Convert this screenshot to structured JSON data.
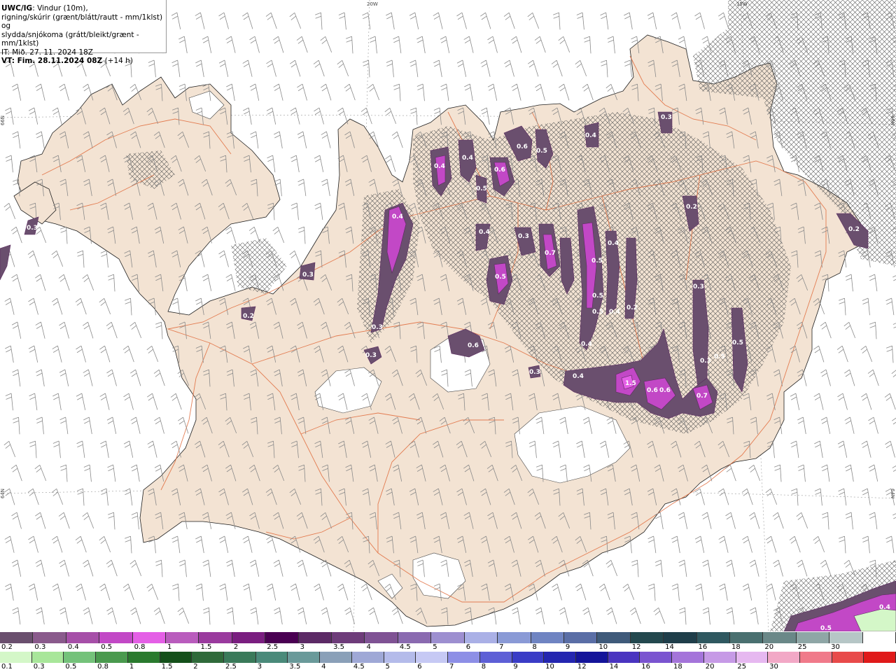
{
  "header": {
    "model": "UWC/IG",
    "line1_rest": ": Vindur (10m),",
    "line2": "rigning/skúrir (grænt/blátt/rautt - mm/1klst) og",
    "line3": "slydda/snjókoma (grátt/bleikt/grænt - mm/1klst)",
    "line4": "IT: Mið. 27. 11. 2024 18Z",
    "vt_label": "VT: Fim. 28.11.2024 08Z",
    "vt_offset": " (+14 h)"
  },
  "geo_labels": {
    "lon_20w": "20W",
    "lon_15w": "15W",
    "lat_66n_left": "66N",
    "lat_66n_right": "66N",
    "lat_64n_left": "64N",
    "lat_64n_right": "64N"
  },
  "precip_labels": [
    "0.3",
    "0.3",
    "0.2",
    "0.4",
    "0.3",
    "0.2",
    "0.6",
    "0.3",
    "0.4",
    "0.4",
    "0.5",
    "0.6",
    "0.6",
    "0.4",
    "0.5",
    "0.4",
    "0.3",
    "0.5",
    "0.7",
    "0.5",
    "0.5",
    "0.4",
    "0.2",
    "0.5",
    "0.3",
    "0.4",
    "0.3",
    "0.2",
    "0.4",
    "0.5",
    "0.7",
    "0.6",
    "1.5",
    "0.6",
    "0.5",
    "0.3",
    "0.4",
    "0.5",
    "0.3",
    "0.2"
  ],
  "legend_top": {
    "colors": [
      "#6a4f6e",
      "#8a5a8c",
      "#a64fa8",
      "#c248c6",
      "#e45fe6",
      "#b95cbd",
      "#9a3a9e",
      "#7a1e80",
      "#4a0052",
      "#5c2a66",
      "#6e3c7a",
      "#7f5294",
      "#8a6ab0",
      "#9d8fd0",
      "#aab0e6",
      "#8a9ad6",
      "#6f84c2",
      "#5a6ea6",
      "#3f5a7a",
      "#23484e",
      "#1f3e4a",
      "#2f5860",
      "#4a7070",
      "#6a8888",
      "#8fa6a6",
      "#b6c6c6",
      "#ffffff"
    ],
    "ticks": [
      "0.2",
      "0.3",
      "0.4",
      "0.5",
      "0.8",
      "1",
      "1.5",
      "2",
      "2.5",
      "3",
      "3.5",
      "4",
      "4.5",
      "5",
      "6",
      "7",
      "8",
      "9",
      "10",
      "12",
      "14",
      "16",
      "18",
      "20",
      "25",
      "30"
    ]
  },
  "legend_bottom": {
    "colors": [
      "#d4f7c8",
      "#a8e69a",
      "#74c27a",
      "#4a9a4e",
      "#2a7a2e",
      "#14501a",
      "#2f6a3a",
      "#3a7a5a",
      "#4a8a7a",
      "#6a9a9a",
      "#8aa0b8",
      "#9fa8d6",
      "#b4bbea",
      "#c6c9f4",
      "#8d8fe6",
      "#5d5fd6",
      "#3a3cc6",
      "#2426b0",
      "#14149a",
      "#4a34c0",
      "#7a54d0",
      "#a474da",
      "#c69ae6",
      "#e6b8f0",
      "#f2a8c6",
      "#f07a8a",
      "#e84a4a",
      "#e01a1a"
    ],
    "ticks": [
      "0.1",
      "0.3",
      "0.5",
      "0.8",
      "1",
      "1.5",
      "2",
      "2.5",
      "3",
      "3.5",
      "4",
      "4.5",
      "5",
      "6",
      "7",
      "8",
      "9",
      "10",
      "12",
      "14",
      "16",
      "18",
      "20",
      "25",
      "30"
    ]
  }
}
